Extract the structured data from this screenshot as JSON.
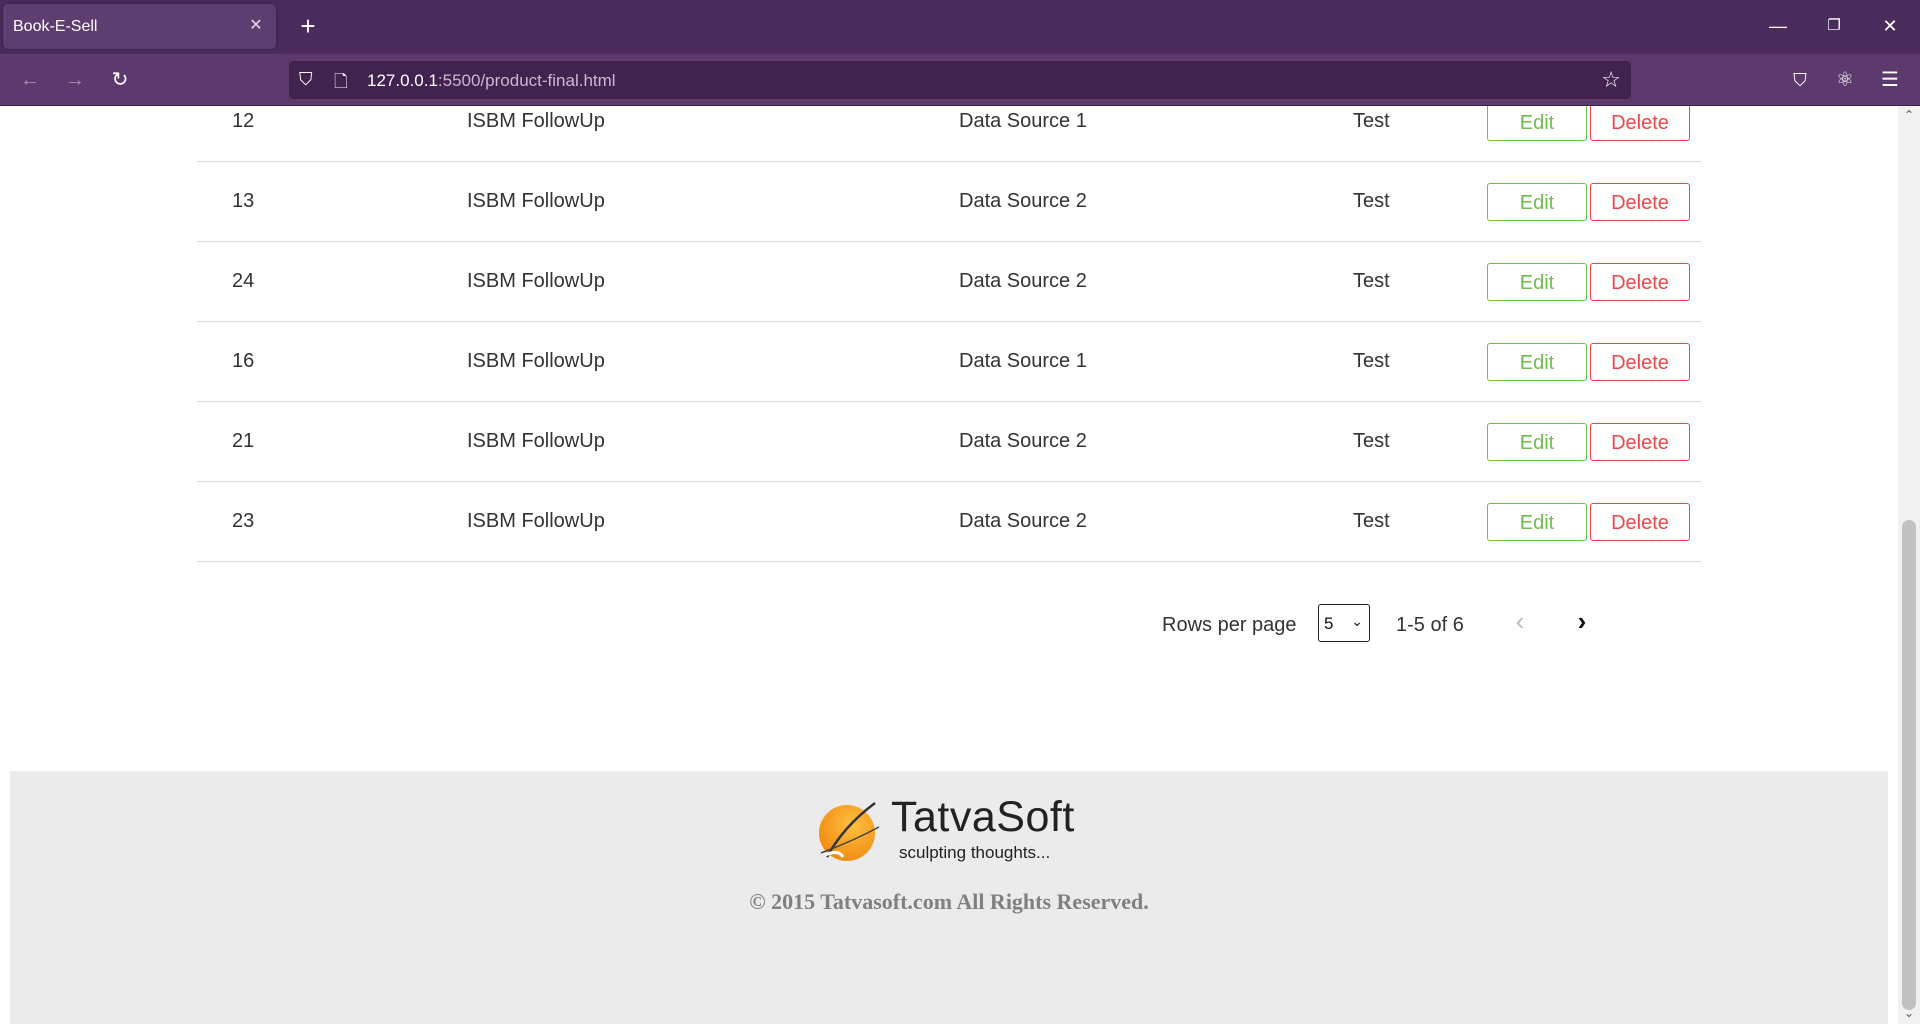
{
  "browser": {
    "tab_title": "Book-E-Sell",
    "url_host": "127.0.0.1",
    "url_path": ":5500/product-final.html"
  },
  "table": {
    "rows": [
      {
        "id": "12",
        "name": "ISBM FollowUp",
        "source": "Data Source 1",
        "category": "Test"
      },
      {
        "id": "13",
        "name": "ISBM FollowUp",
        "source": "Data Source 2",
        "category": "Test"
      },
      {
        "id": "24",
        "name": "ISBM FollowUp",
        "source": "Data Source 2",
        "category": "Test"
      },
      {
        "id": "16",
        "name": "ISBM FollowUp",
        "source": "Data Source 1",
        "category": "Test"
      },
      {
        "id": "21",
        "name": "ISBM FollowUp",
        "source": "Data Source 2",
        "category": "Test"
      },
      {
        "id": "23",
        "name": "ISBM FollowUp",
        "source": "Data Source 2",
        "category": "Test"
      }
    ],
    "edit_label": "Edit",
    "delete_label": "Delete"
  },
  "pagination": {
    "rows_per_page_label": "Rows per page",
    "rows_per_page_value": "5",
    "range_text": "1-5 of 6"
  },
  "footer": {
    "logo_name": "TatvaSoft",
    "logo_tagline": "sculpting thoughts...",
    "copyright": "© 2015 Tatvasoft.com All Rights Reserved."
  },
  "colors": {
    "edit": "#6cc04a",
    "delete": "#f44346",
    "chrome": "#4a2b5c"
  }
}
